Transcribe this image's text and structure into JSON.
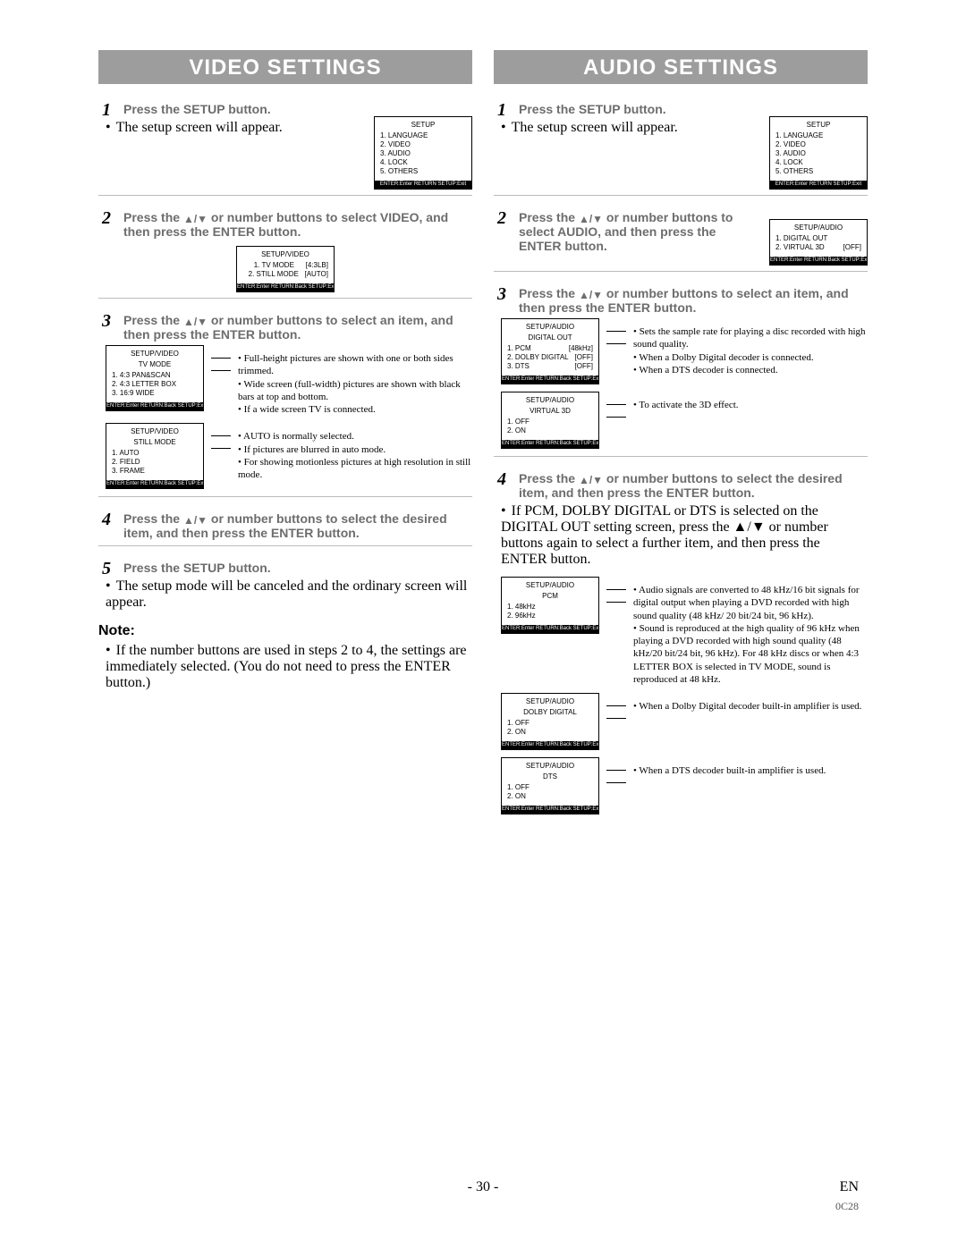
{
  "page": {
    "num": "- 30 -",
    "lang": "EN",
    "code": "0C28"
  },
  "common": {
    "arrows": "▲/▼",
    "osd_foot_a": "ENTER:Enter  RETURN  SETUP:Exit",
    "osd_foot_b": "ENTER:Enter  RETURN:Back  SETUP:Exit"
  },
  "video": {
    "title": "VIDEO SETTINGS",
    "s1": {
      "head": "Press the SETUP button.",
      "body": "The setup screen will appear."
    },
    "s2": {
      "head_a": "Press the ",
      "head_b": " or number buttons to select VIDEO, and then press the ENTER button."
    },
    "s3": {
      "head_a": "Press the ",
      "head_b": " or number buttons to select an item, and then press the ENTER button."
    },
    "s4": {
      "head_a": "Press the ",
      "head_b": " or number buttons to select the desired item, and then press the ENTER button."
    },
    "s5": {
      "head": "Press the SETUP button.",
      "body": "The setup mode will be canceled and the ordinary screen will appear."
    },
    "note_head": "Note:",
    "note_body": "If the number buttons are used in steps 2 to 4, the settings are immediately selected. (You do not need to press the ENTER button.)",
    "osd_setup": {
      "title": "SETUP",
      "items": [
        "1. LANGUAGE",
        "2. VIDEO",
        "3. AUDIO",
        "4. LOCK",
        "5. OTHERS"
      ]
    },
    "osd_video": {
      "title": "SETUP/VIDEO",
      "items": [
        "1. TV MODE",
        "2. STILL MODE"
      ],
      "vals": [
        "[4:3LB]",
        "[AUTO]"
      ]
    },
    "osd_tvmode": {
      "title1": "SETUP/VIDEO",
      "title2": "TV MODE",
      "items": [
        "1. 4:3 PAN&SCAN",
        "2. 4:3 LETTER BOX",
        "3. 16:9 WIDE"
      ],
      "desc": [
        "Full-height pictures are shown with one or both sides trimmed.",
        "Wide screen (full-width) pictures are shown with black bars at top and bottom.",
        "If a wide screen TV is connected."
      ]
    },
    "osd_still": {
      "title1": "SETUP/VIDEO",
      "title2": "STILL MODE",
      "items": [
        "1. AUTO",
        "2. FIELD",
        "3. FRAME"
      ],
      "desc": [
        "AUTO is normally selected.",
        "If pictures are blurred in auto mode.",
        "For showing motionless pictures at high resolution in still mode."
      ]
    }
  },
  "audio": {
    "title": "AUDIO SETTINGS",
    "s1": {
      "head": "Press the SETUP button.",
      "body": "The setup screen will appear."
    },
    "s2": {
      "head_a": "Press the ",
      "head_b": " or number buttons to select AUDIO, and then press the ENTER button."
    },
    "s3": {
      "head_a": "Press the ",
      "head_b": " or number buttons to select an item, and then press the ENTER button."
    },
    "s4": {
      "head_a": "Press the ",
      "head_b": " or number buttons to select the desired item, and then press the ENTER button.",
      "body": "If PCM, DOLBY DIGITAL or DTS is selected on the DIGITAL OUT setting screen, press the ▲/▼ or number buttons again to select a further item, and then press the ENTER button."
    },
    "osd_setup": {
      "title": "SETUP",
      "items": [
        "1. LANGUAGE",
        "2. VIDEO",
        "3. AUDIO",
        "4. LOCK",
        "5. OTHERS"
      ]
    },
    "osd_audio": {
      "title": "SETUP/AUDIO",
      "items": [
        "1. DIGITAL OUT",
        "2. VIRTUAL 3D"
      ],
      "vals": [
        "",
        "[OFF]"
      ]
    },
    "osd_digout": {
      "title1": "SETUP/AUDIO",
      "title2": "DIGITAL OUT",
      "items": [
        "1. PCM",
        "2. DOLBY DIGITAL",
        "3. DTS"
      ],
      "vals": [
        "[48kHz]",
        "[OFF]",
        "[OFF]"
      ],
      "desc": [
        "Sets the sample rate for playing a disc recorded with high sound quality.",
        "When a Dolby Digital decoder is connected.",
        "When a DTS decoder is connected."
      ]
    },
    "osd_v3d": {
      "title1": "SETUP/AUDIO",
      "title2": "VIRTUAL 3D",
      "items": [
        "1. OFF",
        "2. ON"
      ],
      "desc": [
        "To activate the 3D effect."
      ]
    },
    "osd_pcm": {
      "title1": "SETUP/AUDIO",
      "title2": "PCM",
      "items": [
        "1. 48kHz",
        "2. 96kHz"
      ],
      "desc": [
        "Audio signals are converted to 48 kHz/16 bit signals for digital output when playing a DVD recorded with high sound quality (48 kHz/ 20 bit/24 bit, 96 kHz).",
        "Sound is reproduced at the high quality of 96 kHz when playing a DVD recorded with high sound quality (48 kHz/20 bit/24 bit, 96 kHz). For 48 kHz discs or when 4:3 LETTER BOX is selected in TV MODE, sound is reproduced at 48 kHz."
      ]
    },
    "osd_dolby": {
      "title1": "SETUP/AUDIO",
      "title2": "DOLBY DIGITAL",
      "items": [
        "1. OFF",
        "2. ON"
      ],
      "desc": [
        "When a Dolby Digital decoder built-in amplifier is used."
      ]
    },
    "osd_dts": {
      "title1": "SETUP/AUDIO",
      "title2": "DTS",
      "items": [
        "1. OFF",
        "2. ON"
      ],
      "desc": [
        "When a DTS decoder built-in amplifier is used."
      ]
    }
  }
}
